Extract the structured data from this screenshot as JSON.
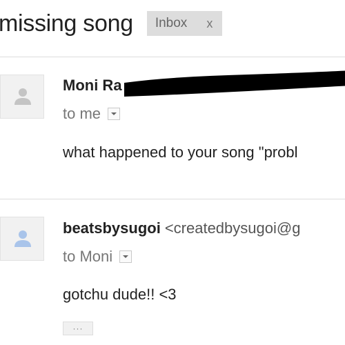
{
  "thread": {
    "subject": "missing song",
    "label": {
      "text": "Inbox",
      "remove_glyph": "x"
    }
  },
  "messages": [
    {
      "sender_name": "Moni Ra",
      "sender_email": "",
      "recipient_text": "to me",
      "body": "what happened to your song \"probl",
      "avatar_icon": "person-icon"
    },
    {
      "sender_name": "beatsbysugoi",
      "sender_email": "<createdbysugoi@g",
      "recipient_text": "to Moni",
      "body": "gotchu dude!! <3",
      "avatar_icon": "person-icon",
      "trimmed_content_label": "···"
    }
  ],
  "colors": {
    "avatar_gray": "#c4c4c4",
    "avatar_blue": "#a9c4ea",
    "redaction": "#000000"
  }
}
